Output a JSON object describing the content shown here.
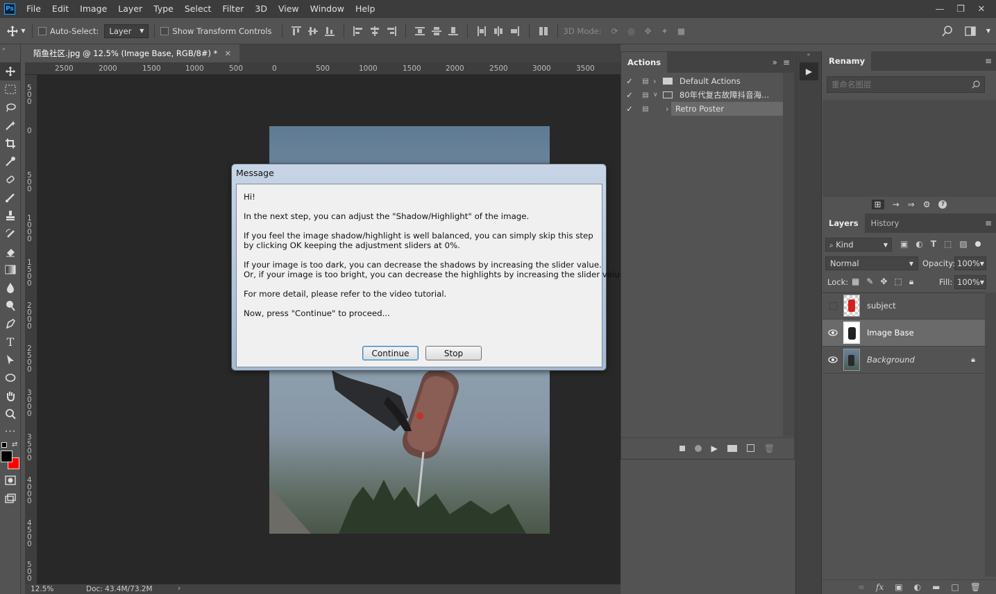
{
  "menubar": {
    "logo": "Ps",
    "items": [
      "File",
      "Edit",
      "Image",
      "Layer",
      "Type",
      "Select",
      "Filter",
      "3D",
      "View",
      "Window",
      "Help"
    ]
  },
  "options": {
    "auto_select_label": "Auto-Select:",
    "auto_select_value": "Layer",
    "show_transform_label": "Show Transform Controls",
    "mode_3d_label": "3D Mode:"
  },
  "document": {
    "tab_title": "陌鱼社区.jpg @ 12.5% (Image Base, RGB/8#) *",
    "ruler_h": [
      "2500",
      "2000",
      "1500",
      "1000",
      "500",
      "0",
      "500",
      "1000",
      "1500",
      "2000",
      "2500",
      "3000",
      "3500"
    ],
    "ruler_v": [
      "5\n0\n0",
      "0",
      "5\n0\n0",
      "1\n0\n0\n0",
      "1\n5\n0\n0",
      "2\n0\n0\n0",
      "2\n5\n0\n0",
      "3\n0\n0\n0",
      "3\n5\n0\n0",
      "4\n0\n0\n0",
      "4\n5\n0\n0",
      "5\n0\n0"
    ],
    "zoom": "12.5%",
    "doc_size": "Doc: 43.4M/73.2M"
  },
  "dialog": {
    "title": "Message",
    "lines": [
      "Hi!",
      "In the next step, you can adjust the \"Shadow/Highlight\" of the image.",
      "If you feel the image shadow/highlight is well balanced, you can simply skip this step",
      "by clicking OK keeping the adjustment sliders at 0%.",
      "If your image is too dark, you can decrease the shadows by increasing the slider value.",
      "Or, if your image is too bright, you can decrease the highlights by increasing the slider value.",
      "For more detail, please refer to the video tutorial.",
      "Now, press \"Continue\" to proceed..."
    ],
    "continue_label": "Continue",
    "stop_label": "Stop"
  },
  "actions_panel": {
    "tab": "Actions",
    "rows": [
      {
        "label": "Default Actions",
        "type": "folder",
        "expanded": false
      },
      {
        "label": "80年代复古故障抖音海...",
        "type": "folder",
        "expanded": true
      },
      {
        "label": "Retro Poster",
        "type": "action",
        "expanded": false
      }
    ]
  },
  "renamy_panel": {
    "tab": "Renamy",
    "search_placeholder": "重命名图层"
  },
  "layers_panel": {
    "tabs": [
      "Layers",
      "History"
    ],
    "kind_label": "Kind",
    "blend_mode": "Normal",
    "opacity_label": "Opacity:",
    "opacity_value": "100%",
    "lock_label": "Lock:",
    "fill_label": "Fill:",
    "fill_value": "100%",
    "layers": [
      {
        "name": "subject",
        "visible": false,
        "selected": false,
        "locked": false
      },
      {
        "name": "Image Base",
        "visible": true,
        "selected": true,
        "locked": false
      },
      {
        "name": "Background",
        "visible": true,
        "selected": false,
        "locked": true
      }
    ]
  },
  "colors": {
    "foreground": "#000000",
    "background": "#ff0000",
    "accent": "#31a8ff"
  }
}
